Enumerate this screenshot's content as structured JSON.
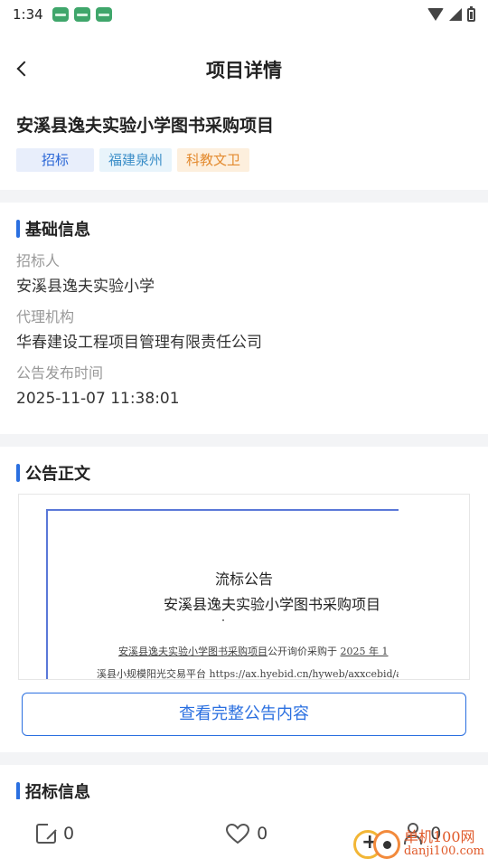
{
  "status_bar": {
    "time": "1:34"
  },
  "nav": {
    "title": "项目详情"
  },
  "project": {
    "title": "安溪县逸夫实验小学图书采购项目",
    "tags": [
      "招标",
      "福建泉州",
      "科教文卫"
    ]
  },
  "basic_info": {
    "heading": "基础信息",
    "fields": [
      {
        "label": "招标人",
        "value": "安溪县逸夫实验小学"
      },
      {
        "label": "代理机构",
        "value": "华春建设工程项目管理有限责任公司"
      },
      {
        "label": "公告发布时间",
        "value": "2025-11-07 11:38:01"
      }
    ]
  },
  "announcement": {
    "heading": "公告正文",
    "doc_title": "流标公告",
    "doc_subtitle": "安溪县逸夫实验小学图书采购项目",
    "doc_line1_underlined": "安溪县逸夫实验小学图书采购项目",
    "doc_line1_rest": "公开询价采购于",
    "doc_line1_year": "2025 年 1",
    "doc_line2": "溪县小规模阳光交易平台 https://ax.hyebid.cn/hyweb/axxcebid/axx",
    "view_button": "查看完整公告内容"
  },
  "bid_info": {
    "heading": "招标信息"
  },
  "bottom_bar": {
    "share_count": "0",
    "like_count": "0",
    "user_count": "0"
  },
  "watermark": {
    "cn": "单机100网",
    "en": "danji100.com"
  },
  "colors": {
    "accent": "#2a6fe0",
    "tag_orange": "#e38a2e"
  }
}
